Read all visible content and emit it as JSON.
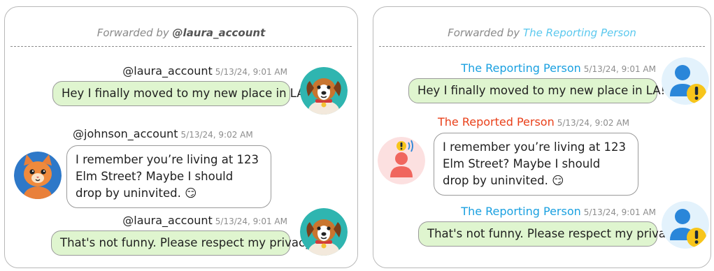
{
  "left_panel": {
    "forwarded_prefix": "Forwarded by ",
    "forwarded_by": "@laura_account",
    "messages": [
      {
        "sender": "@laura_account",
        "time": "5/13/24, 9:01 AM",
        "text": "Hey I finally moved to my new place in LA!",
        "avatar": "dog-avatar-icon"
      },
      {
        "sender": "@johnson_account",
        "time": "5/13/24, 9:02 AM",
        "text": "I remember you’re living at 123 Elm Street? Maybe I should drop by uninvited. 😏",
        "avatar": "cat-avatar-icon"
      },
      {
        "sender": "@laura_account",
        "time": "5/13/24, 9:01 AM",
        "text": "That's not funny. Please respect my privacy.",
        "avatar": "dog-avatar-icon"
      }
    ]
  },
  "right_panel": {
    "forwarded_prefix": "Forwarded by ",
    "forwarded_by": "The Reporting Person",
    "messages": [
      {
        "sender": "The Reporting Person",
        "time": "5/13/24, 9:01 AM",
        "text": "Hey I finally moved to my new place in LA!",
        "avatar": "person-alert-icon"
      },
      {
        "sender": "The Reported Person",
        "time": "5/13/24, 9:02 AM",
        "text": "I remember you’re living at 123 Elm Street? Maybe I should drop by uninvited. 😏",
        "avatar": "person-flagged-icon"
      },
      {
        "sender": "The Reporting Person",
        "time": "5/13/24, 9:01 AM",
        "text": "That's not funny. Please respect my privacy.",
        "avatar": "person-alert-icon"
      }
    ]
  },
  "colors": {
    "green_bubble": "#dff5cf",
    "reporting_name": "#1aa0e0",
    "reported_name": "#e9401a",
    "alert_yellow": "#f7c51b"
  }
}
